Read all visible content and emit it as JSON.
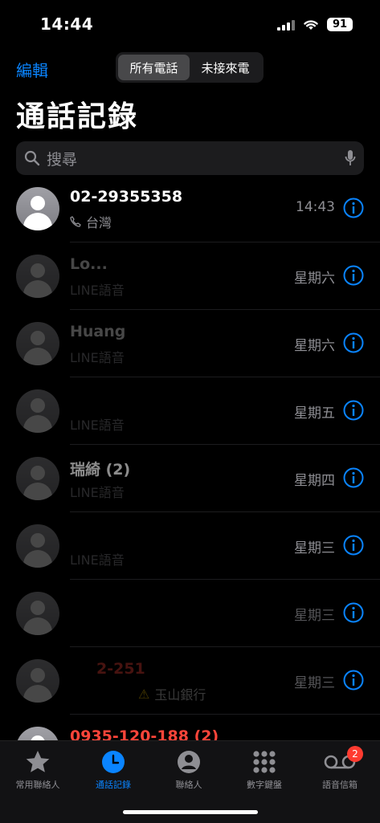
{
  "status": {
    "time": "14:44",
    "battery": "91"
  },
  "nav": {
    "edit": "編輯",
    "segments": [
      {
        "label": "所有電話"
      },
      {
        "label": "未接來電"
      }
    ]
  },
  "title": "通話記錄",
  "search": {
    "placeholder": "搜尋"
  },
  "calls": [
    {
      "name": "02-29355358",
      "type": "台灣",
      "time": "14:43"
    },
    {
      "name": "Lo...",
      "type": "LINE語音",
      "time": "星期六"
    },
    {
      "name": "Huang",
      "type": "LINE語音",
      "time": "星期六"
    },
    {
      "name": "",
      "type": "LINE語音",
      "time": "星期五"
    },
    {
      "name": "瑞綺 (2)",
      "type": "LINE語音",
      "time": "星期四"
    },
    {
      "name": "",
      "type": "LINE語音",
      "time": "星期三"
    },
    {
      "name": "",
      "type": "",
      "time": "星期三"
    },
    {
      "name": "2-251",
      "type": "玉山銀行",
      "time": "星期三"
    },
    {
      "name": "0935-120-188 (2)",
      "type": "",
      "time": ""
    }
  ],
  "tabs": [
    {
      "label": "常用聯絡人",
      "icon": "star-icon"
    },
    {
      "label": "通話記錄",
      "icon": "clock-icon"
    },
    {
      "label": "聯絡人",
      "icon": "person-icon"
    },
    {
      "label": "數字鍵盤",
      "icon": "keypad-icon"
    },
    {
      "label": "語音信箱",
      "icon": "voicemail-icon",
      "badge": "2"
    }
  ],
  "colors": {
    "accent": "#0a84ff",
    "missed": "#ff453a",
    "badge": "#ff3b30"
  }
}
